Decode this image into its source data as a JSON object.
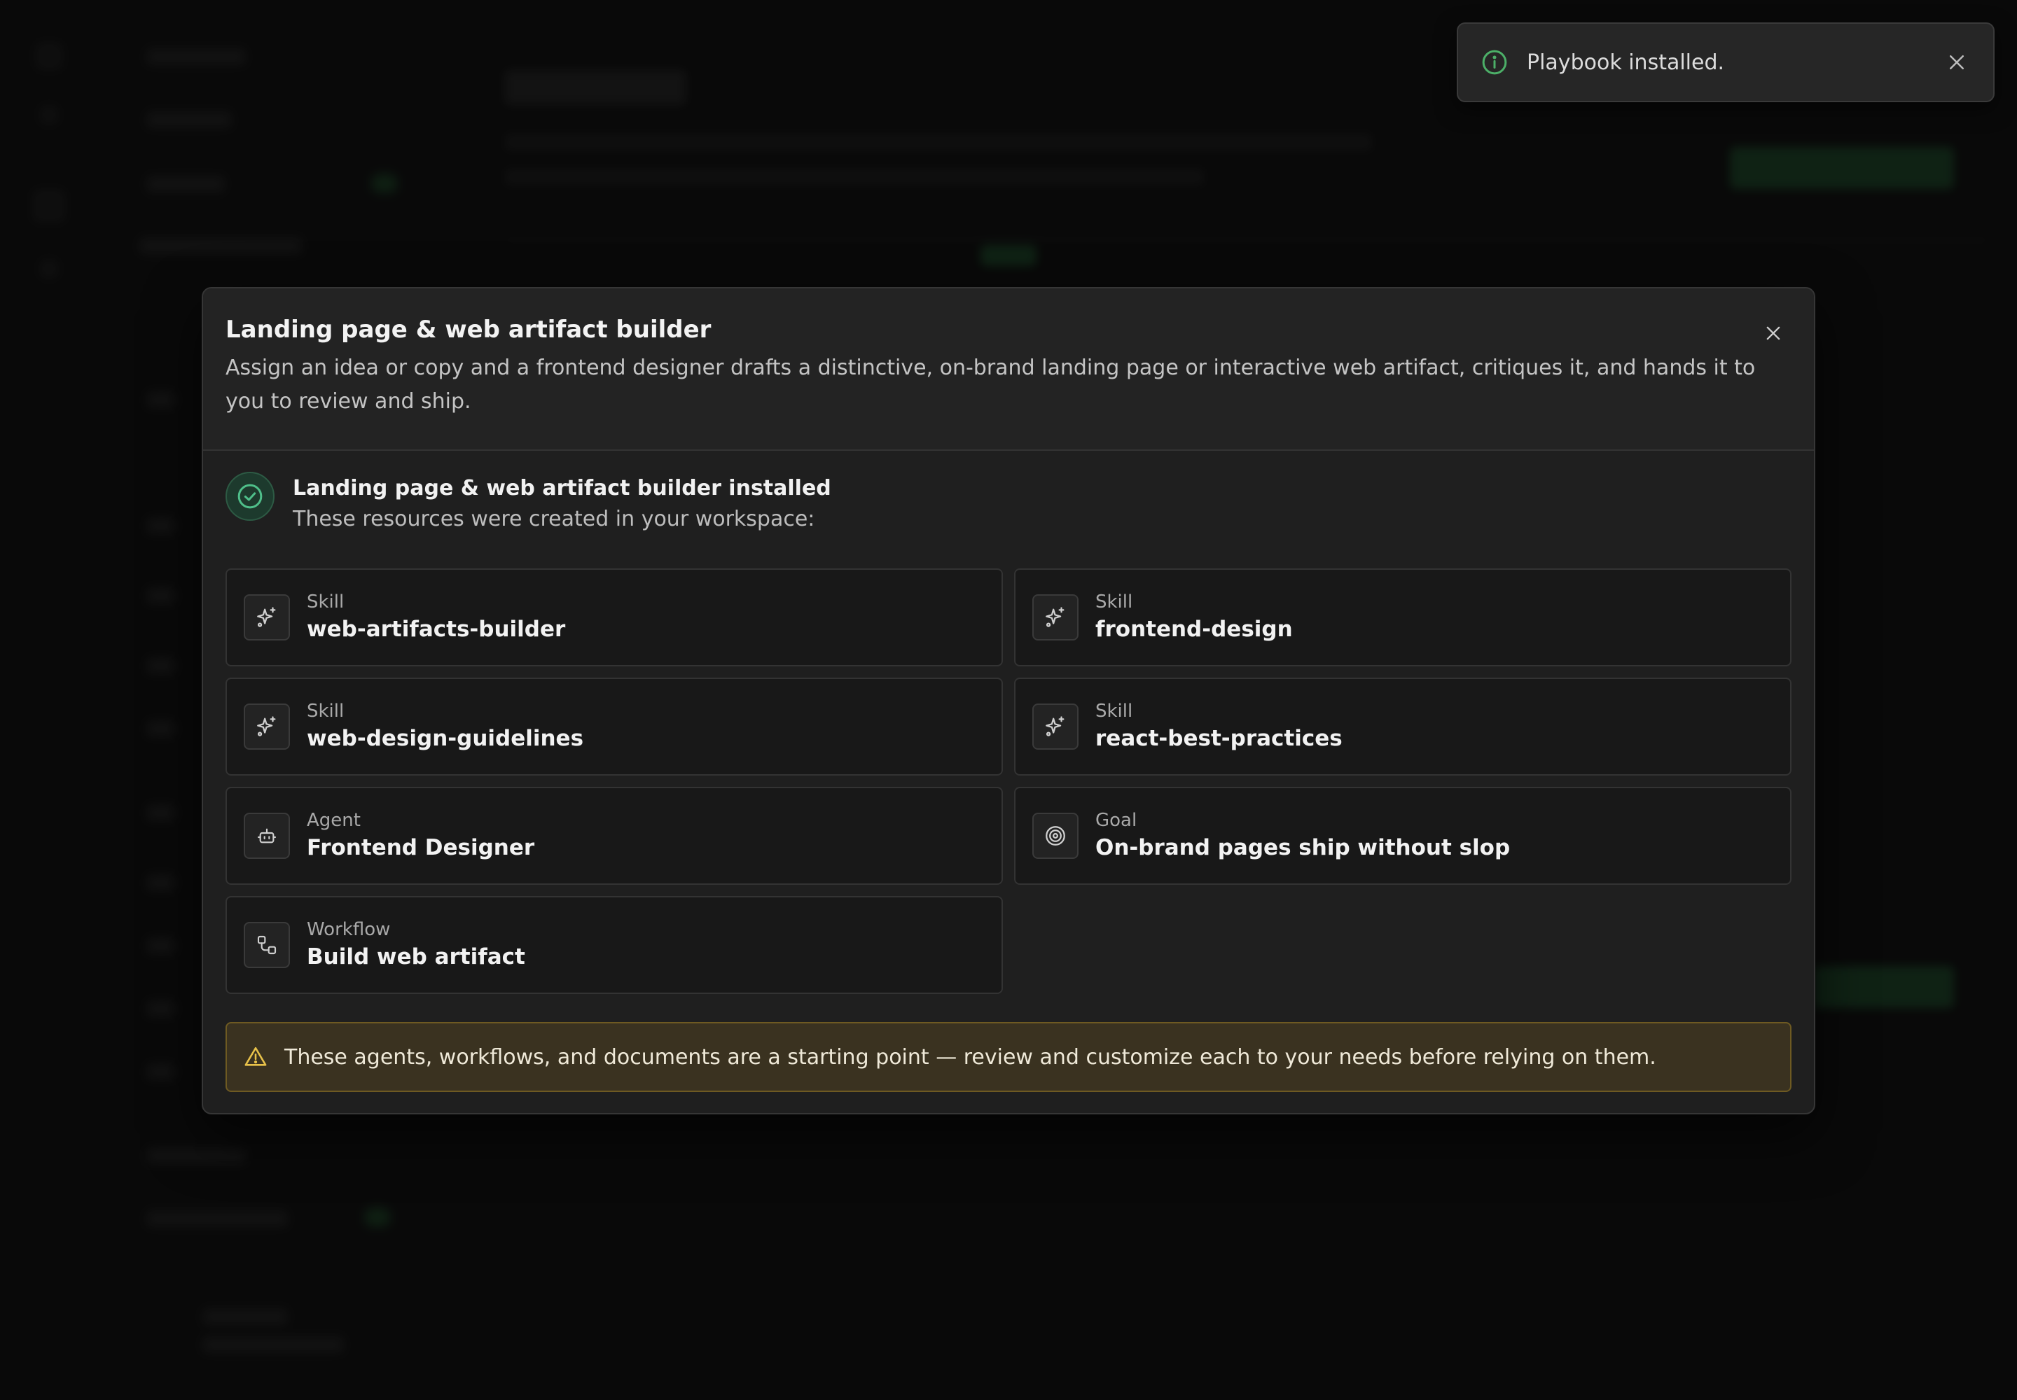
{
  "toast": {
    "message": "Playbook installed.",
    "icon": "info-icon",
    "accent": "#4caf68"
  },
  "modal": {
    "title": "Landing page & web artifact builder",
    "description": "Assign an idea or copy and a frontend designer drafts a distinctive, on-brand landing page or interactive web artifact, critiques it, and hands it to you to review and ship.",
    "success_title": "Landing page & web artifact builder installed",
    "success_subtitle": "These resources were created in your workspace:",
    "resources": [
      {
        "type": "Skill",
        "name": "web-artifacts-builder",
        "icon": "sparkles-icon"
      },
      {
        "type": "Skill",
        "name": "frontend-design",
        "icon": "sparkles-icon"
      },
      {
        "type": "Skill",
        "name": "web-design-guidelines",
        "icon": "sparkles-icon"
      },
      {
        "type": "Skill",
        "name": "react-best-practices",
        "icon": "sparkles-icon"
      },
      {
        "type": "Agent",
        "name": "Frontend Designer",
        "icon": "bot-icon"
      },
      {
        "type": "Goal",
        "name": "On-brand pages ship without slop",
        "icon": "target-icon"
      },
      {
        "type": "Workflow",
        "name": "Build web artifact",
        "icon": "workflow-icon"
      }
    ],
    "warning": "These agents, workflows, and documents are a starting point — review and customize each to your needs before relying on them."
  },
  "colors": {
    "success_green": "#4fbf8a",
    "warning_yellow": "#e8c24a",
    "background": "#141414"
  }
}
